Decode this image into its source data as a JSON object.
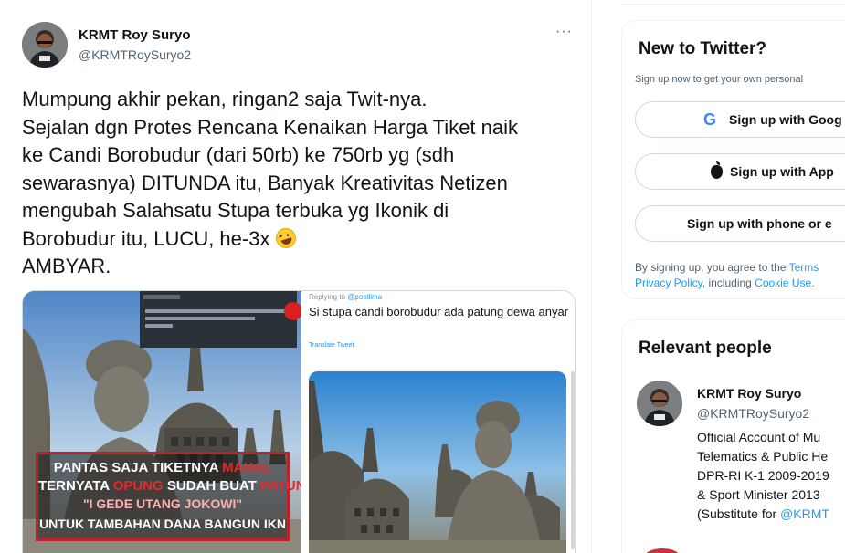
{
  "tweet": {
    "author_name": "KRMT Roy Suryo",
    "author_handle": "@KRMTRoySuryo2",
    "more_glyph": "···",
    "text_lines": [
      "Mumpung akhir pekan, ringan2 saja Twit-nya.",
      "Sejalan dgn Protes Rencana Kenaikan Harga Tiket naik",
      "ke Candi Borobudur (dari 50rb) ke 750rb yg (sdh",
      "sewarasnya) DITUNDA itu, Banyak Kreativitas Netizen",
      "mengubah Salahsatu Stupa terbuka yg Ikonik di",
      "Borobudur itu, LUCU, he-3x",
      "AMBYAR."
    ],
    "emoji_icon": "rolling-on-floor-laughing-emoji"
  },
  "media": {
    "left_caption": {
      "line1_a": "PANTAS SAJA TIKETNYA ",
      "line1_b": "MAHAL",
      "line2_a": "TERNYATA ",
      "line2_b": "OPUNG",
      "line2_c": " SUDAH BUAT ",
      "line2_d": "PATUNG",
      "line3": "\"I GEDE UTANG JOKOWI\"",
      "line4": "UNTUK TAMBAHAN DANA BANGUN IKN"
    },
    "right_panel": {
      "replying_prefix": "Replying to ",
      "replying_handle": "@postlima",
      "reply_text": "Si stupa candi borobudur ada patung dewa anyar",
      "translate_label": "Translate Tweet"
    },
    "colors": {
      "caption_border": "#c0202a",
      "caption_red": "#e42b2b"
    }
  },
  "sidebar": {
    "new_to_twitter": {
      "title": "New to Twitter?",
      "subtitle": "Sign up now to get your own personal",
      "google_button": "Sign up with Goog",
      "apple_button": "Sign up with App",
      "phone_button": "Sign up with phone or e",
      "terms_prefix": "By signing up, you agree to the ",
      "terms_link": "Terms",
      "privacy_link": "Privacy Policy",
      "terms_middle": ", including ",
      "cookie_link": "Cookie Use",
      "terms_end": "."
    },
    "relevant_people": {
      "title": "Relevant people",
      "name": "KRMT Roy Suryo",
      "handle": "@KRMTRoySuryo2",
      "bio_lines": [
        "Official Account of Mu",
        "Telematics & Public He",
        "DPR-RI K-1 2009-2019",
        "& Sport Minister 2013-"
      ],
      "bio_last_prefix": "(Substitute for ",
      "bio_last_link": "@KRMT"
    }
  },
  "colors": {
    "link": "#1d9bf0",
    "text": "#0f1419",
    "muted": "#536471"
  }
}
